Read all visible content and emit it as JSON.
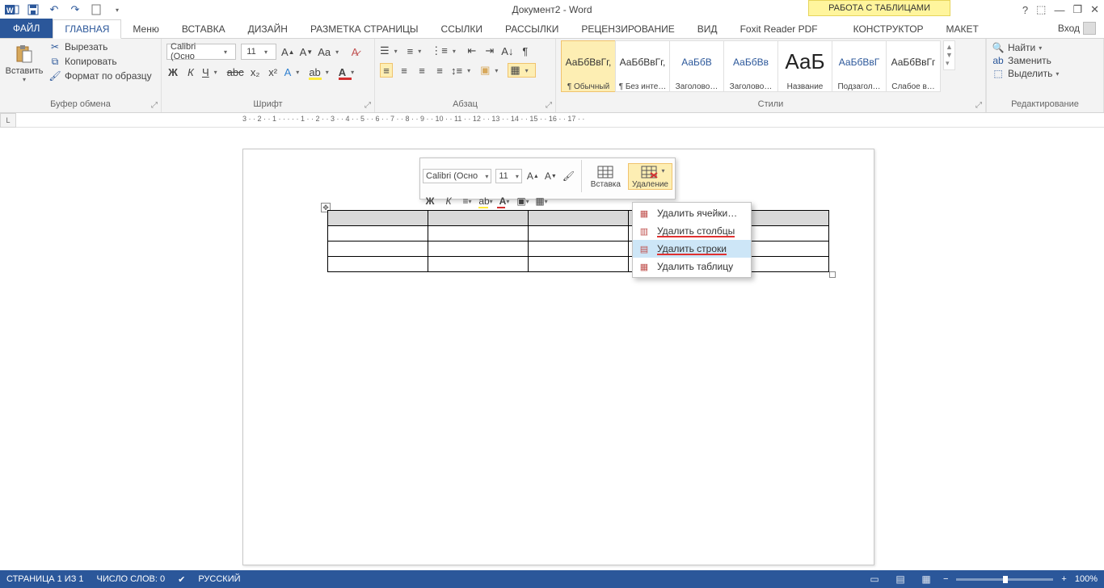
{
  "title": "Документ2 - Word",
  "tabletools_banner": "РАБОТА С ТАБЛИЦАМИ",
  "qat": {
    "dropdown": "▾"
  },
  "window_controls": {
    "help": "?",
    "ribbon": "⬚",
    "min": "—",
    "restore": "❐",
    "close": "✕"
  },
  "tabs": {
    "file": "ФАЙЛ",
    "home": "ГЛАВНАЯ",
    "menu": "Меню",
    "insert": "ВСТАВКА",
    "design": "ДИЗАЙН",
    "layout": "РАЗМЕТКА СТРАНИЦЫ",
    "references": "ССЫЛКИ",
    "mailings": "РАССЫЛКИ",
    "review": "РЕЦЕНЗИРОВАНИЕ",
    "view": "ВИД",
    "foxit": "Foxit Reader PDF",
    "constructor": "КОНСТРУКТОР",
    "tlayout": "МАКЕТ",
    "login": "Вход"
  },
  "ribbon": {
    "clipboard": {
      "paste": "Вставить",
      "cut": "Вырезать",
      "copy": "Копировать",
      "format_painter": "Формат по образцу",
      "label": "Буфер обмена"
    },
    "font": {
      "name": "Calibri (Осно",
      "size": "11",
      "label": "Шрифт"
    },
    "paragraph": {
      "label": "Абзац"
    },
    "styles": {
      "label": "Стили",
      "items": [
        {
          "preview": "АаБбВвГг,",
          "name": "¶ Обычный",
          "sel": true
        },
        {
          "preview": "АаБбВвГг,",
          "name": "¶ Без инте…"
        },
        {
          "preview": "АаБбВ",
          "name": "Заголово…",
          "blue": true
        },
        {
          "preview": "АаБбВв",
          "name": "Заголово…",
          "blue": true
        },
        {
          "preview": "АаБ",
          "name": "Название",
          "huge": true
        },
        {
          "preview": "АаБбВвГ",
          "name": "Подзагол…",
          "blue": true
        },
        {
          "preview": "АаБбВвГг",
          "name": "Слабое в…"
        }
      ]
    },
    "editing": {
      "find": "Найти",
      "replace": "Заменить",
      "select": "Выделить",
      "label": "Редактирование"
    }
  },
  "ruler": "3 · · 2 · · 1 · · · · · 1 · · 2 · · 3 · · 4 · · 5 · · 6 · · 7 · · 8 · · 9 · · 10 · · 11 · · 12 · · 13 · · 14 · · 15 · · 16 · · 17 · ·",
  "minibar": {
    "font": "Calibri (Осно",
    "size": "11",
    "insert": "Вставка",
    "delete": "Удаление"
  },
  "menu": {
    "delete_cells": "Удалить ячейки…",
    "delete_columns": "Удалить столбцы",
    "delete_rows": "Удалить строки",
    "delete_table": "Удалить таблицу"
  },
  "status": {
    "page": "СТРАНИЦА 1 ИЗ 1",
    "words": "ЧИСЛО СЛОВ: 0",
    "lang": "РУССКИЙ",
    "zoom": "100%"
  }
}
